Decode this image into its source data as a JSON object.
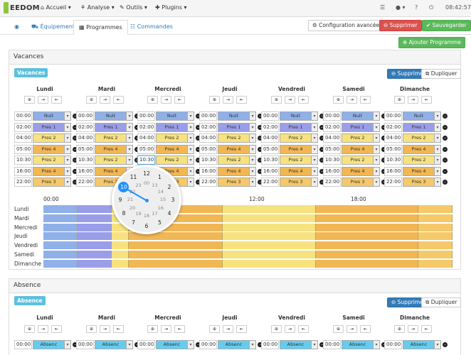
{
  "navbar": {
    "logo_text": "EEDOM",
    "items": [
      "Accueil",
      "Analyse",
      "Outils",
      "Plugins"
    ],
    "time": "08:42:57"
  },
  "tabs": [
    "Équipement",
    "Programmes",
    "Commandes"
  ],
  "actions": {
    "config": "Configuration avancée",
    "delete": "Supprimer",
    "save": "Sauvegarder",
    "add_program": "Ajouter Programme"
  },
  "days": [
    "Lundi",
    "Mardi",
    "Mercredi",
    "Jeudi",
    "Vendredi",
    "Samedi",
    "Dimanche"
  ],
  "program1": {
    "title": "Vacances",
    "tag": "Vacances",
    "delete": "Supprimer",
    "duplicate": "Dupliquer",
    "rows": [
      {
        "time": "00:00",
        "mode": "Nuit",
        "color": "#8fb0e8"
      },
      {
        "time": "02:00",
        "mode": "Pres 1",
        "color": "#9a9ee8"
      },
      {
        "time": "04:00",
        "mode": "Pres 2",
        "color": "#f7e27f"
      },
      {
        "time": "05:00",
        "mode": "Pres 4",
        "color": "#f2b755"
      },
      {
        "time": "10:30",
        "mode": "Pres 2",
        "color": "#f7e27f"
      },
      {
        "time": "16:00",
        "mode": "Pres 4",
        "color": "#f2b755"
      },
      {
        "time": "22:00",
        "mode": "Pres 3",
        "color": "#f5c96a"
      }
    ],
    "editing_time": "10:30",
    "timeline_axis": [
      "00:00",
      "12:00",
      "18:00"
    ]
  },
  "clock": {
    "outer": [
      "12",
      "1",
      "2",
      "3",
      "4",
      "5",
      "6",
      "7",
      "8",
      "9",
      "10",
      "11"
    ],
    "inner": [
      "00",
      "13",
      "14",
      "15",
      "16",
      "17",
      "18",
      "19",
      "20",
      "21",
      "22",
      "23"
    ],
    "selected": "10"
  },
  "program2": {
    "title": "Absence",
    "tag": "Absence",
    "delete": "Supprimer",
    "duplicate": "Dupliquer",
    "rows": [
      {
        "time": "00:00",
        "mode": "Absenc",
        "color": "#66ccee"
      }
    ]
  },
  "colors": {
    "nuit": "#8fb0e8",
    "pres1": "#9a9ee8",
    "pres2": "#f7e27f",
    "pres3": "#f5c96a",
    "pres4": "#f2b755",
    "absence": "#66ccee"
  }
}
